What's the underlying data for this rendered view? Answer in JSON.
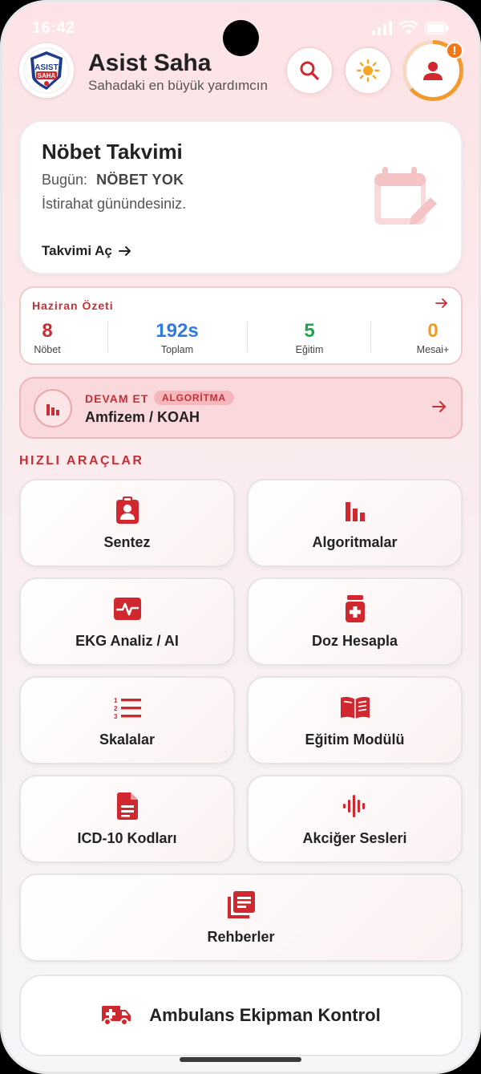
{
  "status": {
    "time": "16:42"
  },
  "header": {
    "app_title": "Asist Saha",
    "subtitle": "Sahadaki en büyük yardımcın",
    "logo_text_top": "ASIST",
    "logo_text_bottom": "SAHA",
    "notification_badge": "!"
  },
  "calendar": {
    "title": "Nöbet Takvimi",
    "today_label": "Bugün:",
    "today_value": "NÖBET YOK",
    "description": "İstirahat günündesiniz.",
    "open_link": "Takvimi Aç"
  },
  "summary": {
    "title": "Haziran Özeti",
    "stats": [
      {
        "value": "8",
        "label": "Nöbet",
        "color": "#c62f34"
      },
      {
        "value": "192s",
        "label": "Toplam",
        "color": "#2f7be0"
      },
      {
        "value": "5",
        "label": "Eğitim",
        "color": "#1aa84a"
      },
      {
        "value": "0",
        "label": "Mesai+",
        "color": "#f39a1f"
      }
    ]
  },
  "continue": {
    "label": "DEVAM ET",
    "badge": "ALGORİTMA",
    "name": "Amfizem / KOAH"
  },
  "quick_tools": {
    "title": "HIZLI ARAÇLAR",
    "items": [
      {
        "label": "Sentez",
        "icon": "clipboard-user-icon"
      },
      {
        "label": "Algoritmalar",
        "icon": "bar-chart-icon"
      },
      {
        "label": "EKG Analiz / AI",
        "icon": "heart-pulse-icon"
      },
      {
        "label": "Doz Hesapla",
        "icon": "medicine-bottle-icon"
      },
      {
        "label": "Skalalar",
        "icon": "numbered-list-icon"
      },
      {
        "label": "Eğitim Modülü",
        "icon": "open-book-icon"
      },
      {
        "label": "ICD-10 Kodları",
        "icon": "document-icon"
      },
      {
        "label": "Akciğer Sesleri",
        "icon": "sound-wave-icon"
      },
      {
        "label": "Rehberler",
        "icon": "library-books-icon"
      }
    ]
  },
  "ambulance": {
    "label": "Ambulans Ekipman Kontrol",
    "icon": "ambulance-icon"
  },
  "colors": {
    "accent": "#c62f34",
    "icon_red": "#d0282e",
    "ring_orange": "#f39a2f"
  }
}
